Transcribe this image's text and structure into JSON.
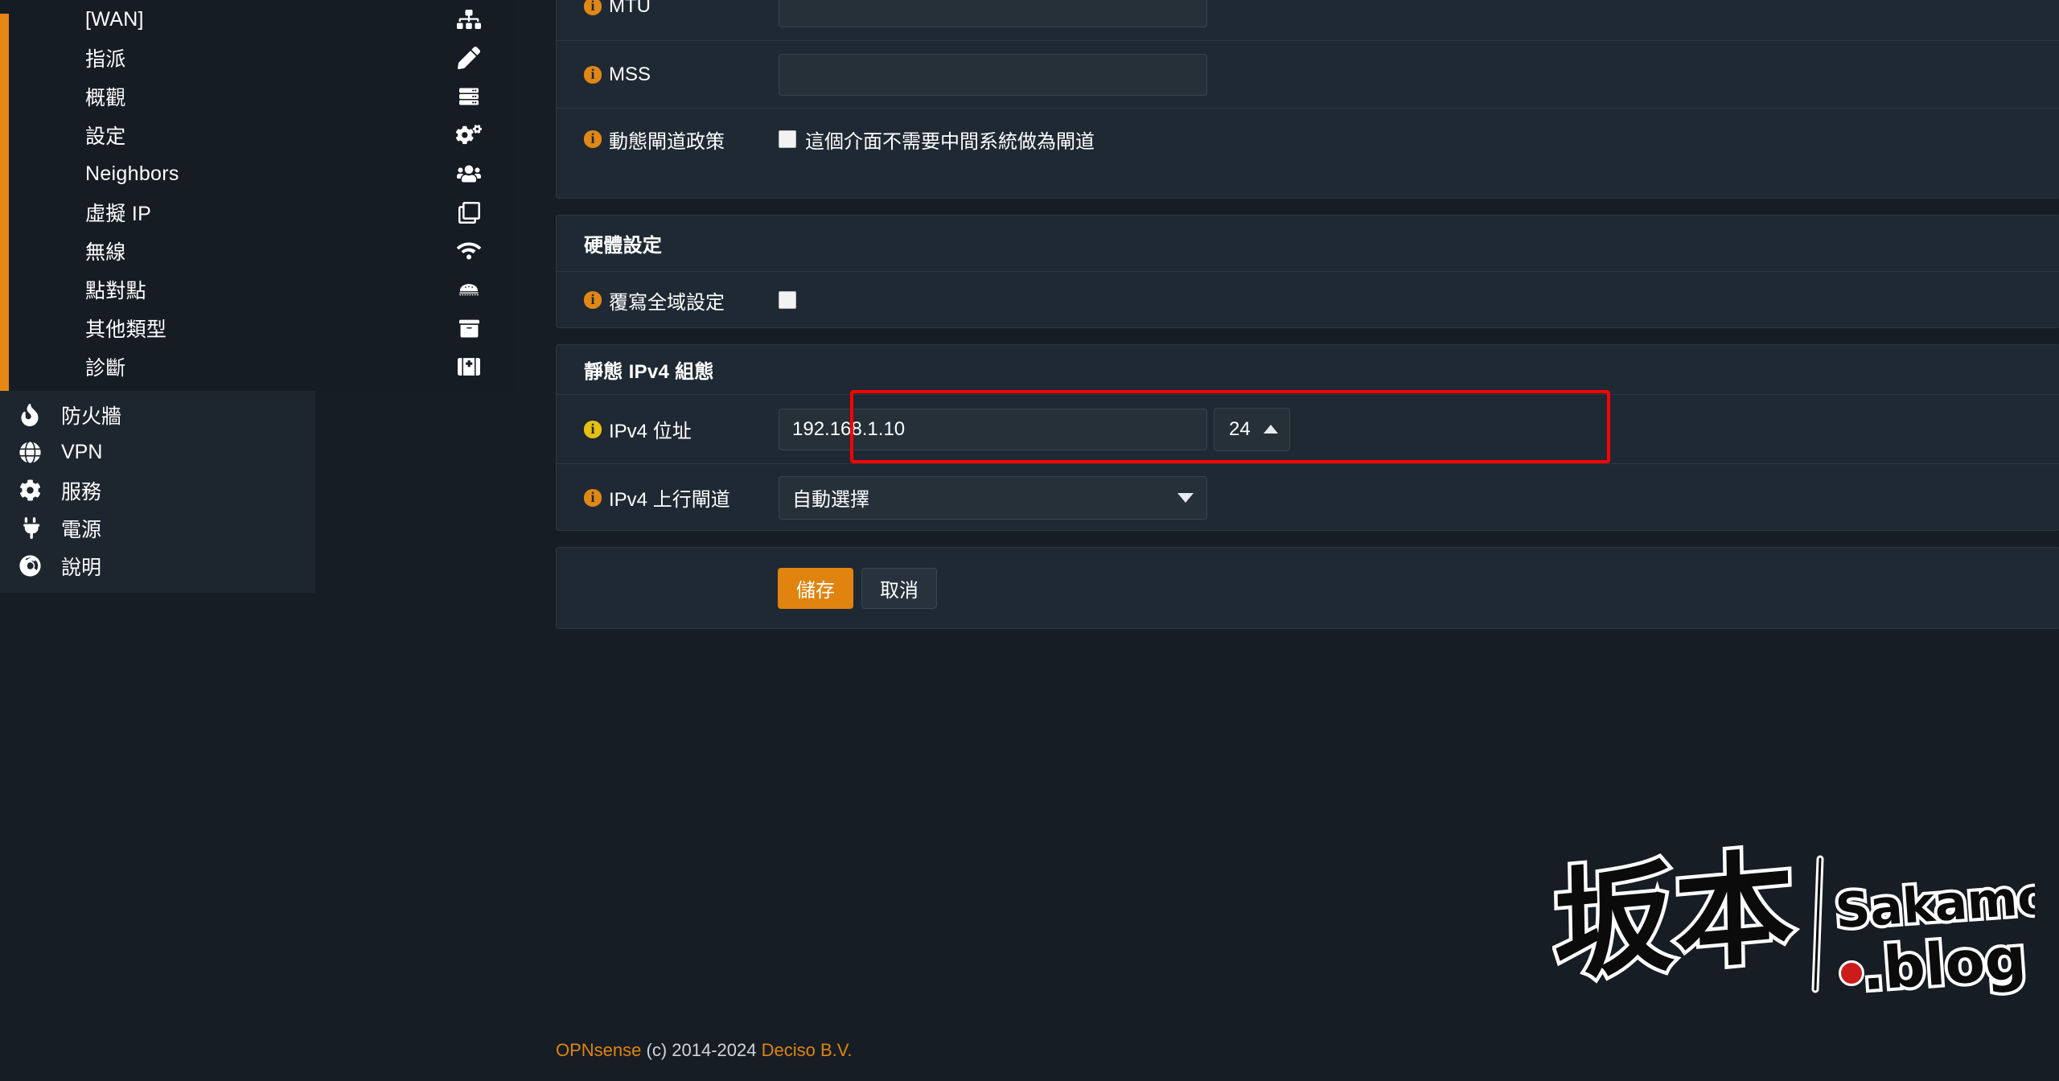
{
  "sidebar": {
    "submenu_items": [
      {
        "label": "[WAN]",
        "icon": "sitemap-icon"
      },
      {
        "label": "指派",
        "icon": "pencil-icon"
      },
      {
        "label": "概觀",
        "icon": "server-icon"
      },
      {
        "label": "設定",
        "icon": "gears-icon"
      },
      {
        "label": "Neighbors",
        "icon": "users-icon"
      },
      {
        "label": "虛擬 IP",
        "icon": "clone-icon"
      },
      {
        "label": "無線",
        "icon": "wifi-icon"
      },
      {
        "label": "點對點",
        "icon": "modem-icon"
      },
      {
        "label": "其他類型",
        "icon": "archive-icon"
      },
      {
        "label": "診斷",
        "icon": "first-aid-icon"
      }
    ],
    "main_items": [
      {
        "label": "防火牆",
        "icon": "fire-icon"
      },
      {
        "label": "VPN",
        "icon": "globe-icon"
      },
      {
        "label": "服務",
        "icon": "gear-icon"
      },
      {
        "label": "電源",
        "icon": "plug-icon"
      },
      {
        "label": "說明",
        "icon": "lifering-icon"
      }
    ]
  },
  "form": {
    "mtu": {
      "label": "MTU",
      "value": "",
      "placeholder": ""
    },
    "mss": {
      "label": "MSS",
      "value": "",
      "placeholder": ""
    },
    "dynamic_gateway": {
      "label": "動態閘道政策",
      "checkbox_label": "這個介面不需要中間系統做為閘道",
      "checked": false
    },
    "hardware_section": {
      "title": "硬體設定",
      "override_label": "覆寫全域設定",
      "override_checked": false
    },
    "static_ipv4_section": {
      "title": "靜態 IPv4 組態",
      "address_label": "IPv4 位址",
      "address_value": "192.168.1.10",
      "subnet_value": "24",
      "gateway_label": "IPv4 上行閘道",
      "gateway_value": "自動選擇"
    },
    "buttons": {
      "save": "儲存",
      "cancel": "取消"
    }
  },
  "footer": {
    "brand": "OPNsense",
    "copyright": "(c) 2014-2024",
    "company": "Deciso B.V."
  },
  "watermark": {
    "kanji": "坂本",
    "name": "Sakamoto",
    "domain": ".blog"
  },
  "colors": {
    "accent_orange": "#e0840f",
    "highlight_red": "#fe0000",
    "panel_bg": "#1f2933",
    "page_bg": "#161d24",
    "info_orange": "#df8717",
    "info_gold": "#e6c013"
  }
}
